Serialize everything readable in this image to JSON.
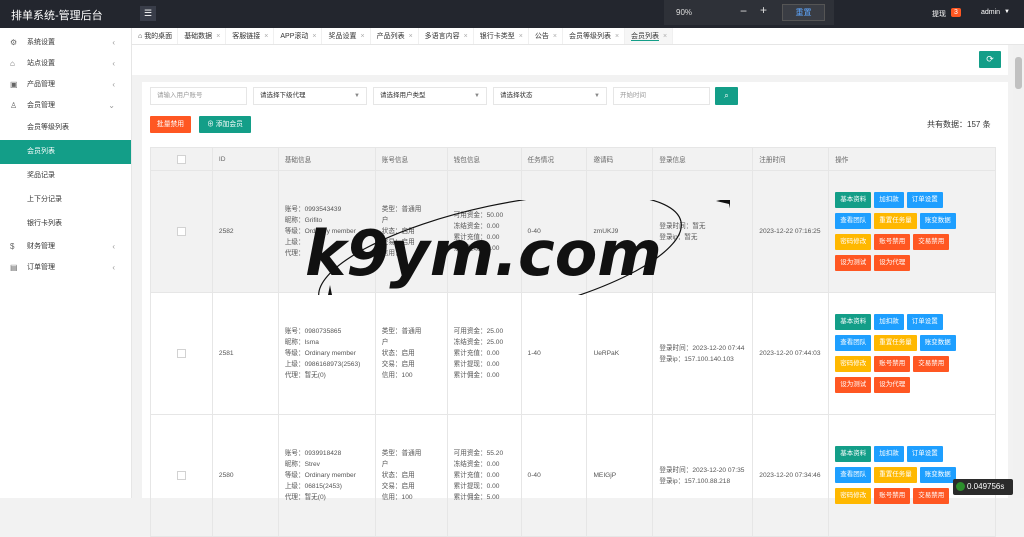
{
  "header": {
    "title": "排单系统-管理后台",
    "withdraw_label": "提现",
    "withdraw_badge": "3",
    "user": "admin",
    "menu_icon": "hamburger-icon"
  },
  "zoom": {
    "percent": "90%",
    "minus": "−",
    "plus": "+",
    "reset": "重置"
  },
  "sidebar": {
    "items": [
      {
        "label": "系统设置",
        "icon": "gear-icon"
      },
      {
        "label": "站点设置",
        "icon": "home-icon"
      },
      {
        "label": "产品管理",
        "icon": "app-icon"
      },
      {
        "label": "会员管理",
        "icon": "user-icon"
      }
    ],
    "sub_items": [
      "会员等级列表",
      "会员列表",
      "奖品记录",
      "上下分记录",
      "银行卡列表"
    ],
    "bottom_items": [
      {
        "label": "财务管理",
        "icon": "money-icon"
      },
      {
        "label": "订单管理",
        "icon": "order-icon"
      }
    ]
  },
  "tabs": [
    "我的桌面",
    "基础数据",
    "客服链接",
    "APP滚动",
    "奖品设置",
    "产品列表",
    "多语言内容",
    "银行卡类型",
    "公告",
    "会员等级列表",
    "会员列表"
  ],
  "filters": {
    "account_placeholder": "请输入用户账号",
    "agent_select": "请选择下级代理",
    "type_select": "请选择用户类型",
    "status_select": "请选择状态",
    "time_placeholder": "开始时间"
  },
  "actions": {
    "batch_disable": "批量禁用",
    "add_member": "添加会员",
    "total": "共有数据：157 条"
  },
  "table": {
    "headers": [
      "ID",
      "基础信息",
      "账号信息",
      "钱包信息",
      "任务情况",
      "邀请码",
      "登录信息",
      "注册时间",
      "操作"
    ],
    "rows": [
      {
        "id": "2582",
        "basic": [
          "账号：0993543439",
          "昵称：Grifito",
          "等级：Ordinary member",
          "上级：",
          "代理："
        ],
        "account": [
          "类型：普通用",
          "户",
          "状态：启用",
          "交易：启用",
          "信用："
        ],
        "wallet": [
          "可用资金：50.00",
          "冻结资金：0.00",
          "累计充值：0.00",
          "累计提现：0.00",
          ""
        ],
        "task": "0-40",
        "invite": "zmUKJ9",
        "login": [
          "登录时间：暂无",
          "登录ip：暂无"
        ],
        "reg": "2023-12-22 07:16:25"
      },
      {
        "id": "2581",
        "basic": [
          "账号：0980735865",
          "昵称：Isma",
          "等级：Ordinary member",
          "上级：0986168973(2563)",
          "代理：暂无(0)"
        ],
        "account": [
          "类型：普通用",
          "户",
          "状态：启用",
          "交易：启用",
          "信用：100"
        ],
        "wallet": [
          "可用资金：25.00",
          "冻结资金：25.00",
          "累计充值：0.00",
          "累计提现：0.00",
          "累计佣金：0.00"
        ],
        "task": "1-40",
        "invite": "UeRPaK",
        "login": [
          "登录时间：2023-12-20 07:44",
          "登录ip：157.100.140.103"
        ],
        "reg": "2023-12-20 07:44:03"
      },
      {
        "id": "2580",
        "basic": [
          "账号：0939918428",
          "昵称：Strev",
          "等级：Ordinary member",
          "上级：06815(2453)",
          "代理：暂无(0)"
        ],
        "account": [
          "类型：普通用",
          "户",
          "状态：启用",
          "交易：启用",
          "信用：100"
        ],
        "wallet": [
          "可用资金：55.20",
          "冻结资金：0.00",
          "累计充值：0.00",
          "累计提现：0.00",
          "累计佣金：5.00"
        ],
        "task": "0-40",
        "invite": "MEIGjP",
        "login": [
          "登录时间：2023-12-20 07:35",
          "登录ip：157.100.88.218"
        ],
        "reg": "2023-12-20 07:34:46"
      }
    ],
    "op_buttons": [
      "基本资料",
      "加扣款",
      "订单设置",
      "查看团队",
      "重置任务量",
      "账变数据",
      "密码修改",
      "账号禁用",
      "交易禁用",
      "设为测试",
      "设为代理"
    ]
  },
  "watermark": "k9ym.com",
  "status_timer": "0.049756s",
  "colors": {
    "accent": "#139e88",
    "orange": "#ff5722",
    "blue": "#1e9fff",
    "yellow": "#ffb800",
    "header": "#23262e"
  }
}
